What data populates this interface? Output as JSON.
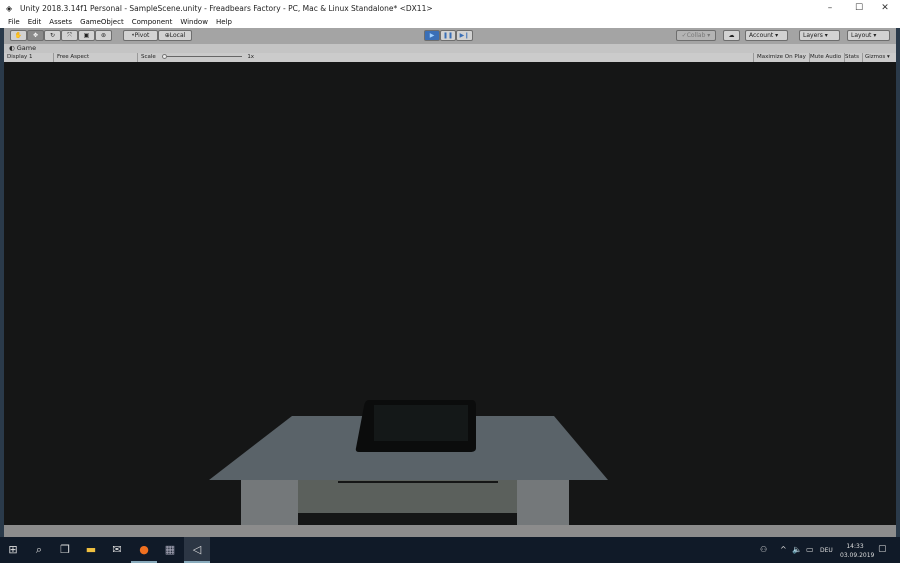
{
  "window": {
    "title": "Unity 2018.3.14f1 Personal - SampleScene.unity - Freadbears Factory - PC, Mac & Linux Standalone* <DX11>",
    "controls": [
      "minimize-icon",
      "maximize-icon",
      "close-icon"
    ]
  },
  "menu": [
    "File",
    "Edit",
    "Assets",
    "GameObject",
    "Component",
    "Window",
    "Help"
  ],
  "toolbar": {
    "pivot": "Pivot",
    "local": "Local",
    "collab": "Collab",
    "account": "Account",
    "layers": "Layers",
    "layout": "Layout"
  },
  "game": {
    "tab": "Game",
    "display": "Display 1",
    "aspect": "Free Aspect",
    "scale_label": "Scale",
    "scale_value": "1x",
    "maximize": "Maximize On Play",
    "mute": "Mute Audio",
    "stats": "Stats",
    "gizmos": "Gizmos"
  },
  "taskbar": {
    "lang": "DEU",
    "time": "14:33",
    "date": "03.09.2019"
  },
  "colors": {
    "play_accent": "#3a6fb7",
    "view_bg": "#151616"
  }
}
